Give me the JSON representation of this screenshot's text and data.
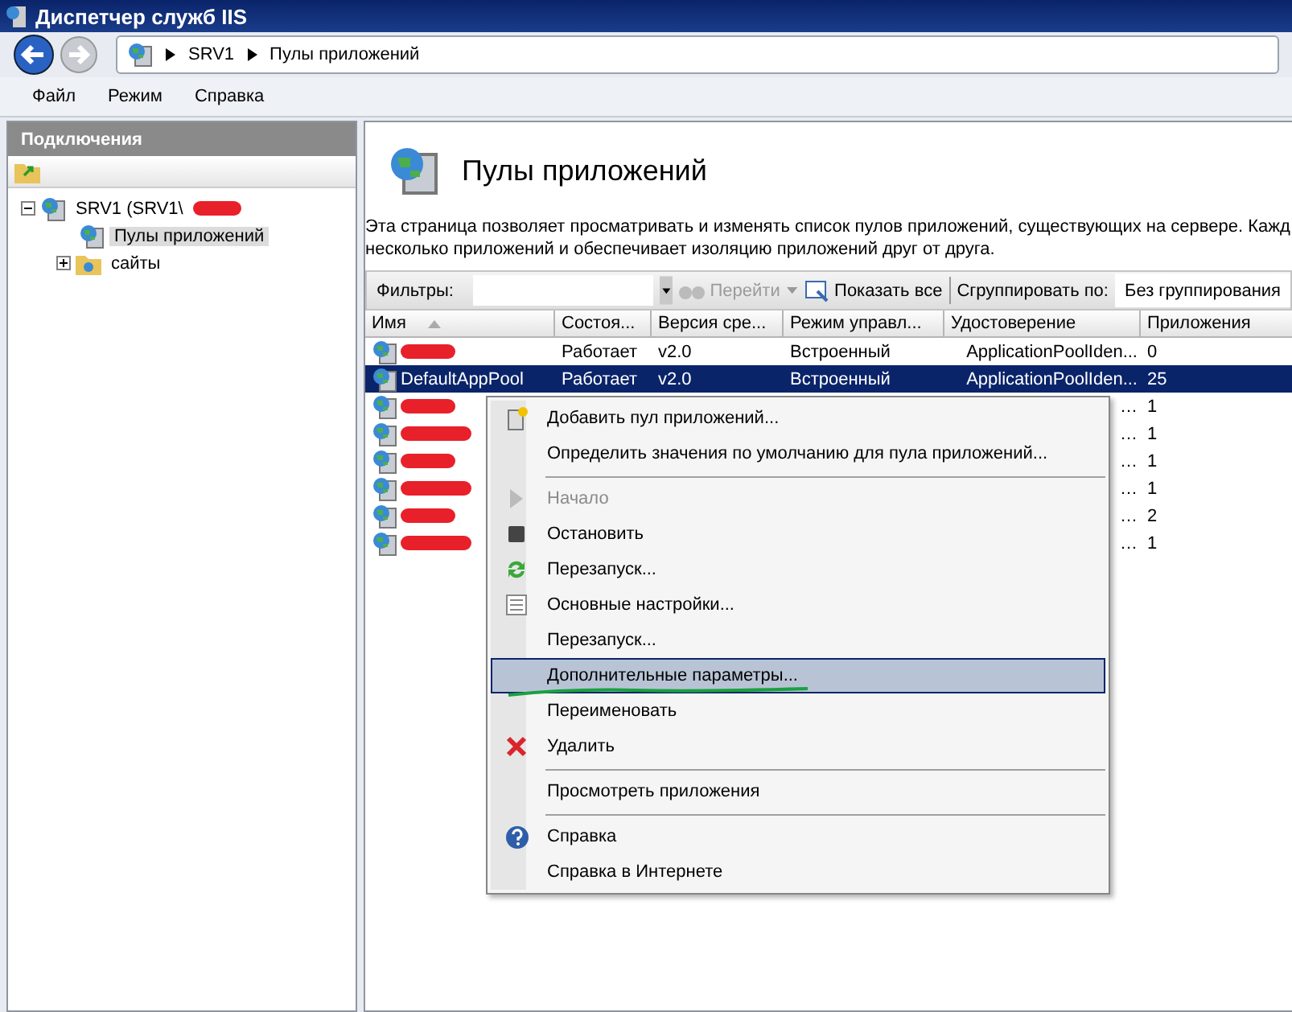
{
  "window": {
    "title": "Диспетчер служб IIS"
  },
  "address": {
    "crumbs": [
      "SRV1",
      "Пулы приложений"
    ]
  },
  "menu_bar": [
    "Файл",
    "Режим",
    "Справка"
  ],
  "connections": {
    "title": "Подключения",
    "tree": [
      {
        "label": "SRV1 (SRV1\\",
        "redacted": true,
        "expanded": true,
        "selected": false,
        "children": [
          {
            "label": "Пулы приложений",
            "redacted": false,
            "selected": true
          },
          {
            "label": "сайты",
            "redacted": false,
            "selected": false,
            "expanded": false
          }
        ]
      }
    ]
  },
  "page": {
    "title": "Пулы приложений",
    "description": [
      "Эта страница позволяет просматривать и изменять список пулов приложений, существующих на сервере. Кажд",
      "несколько приложений и обеспечивает изоляцию приложений друг от друга."
    ]
  },
  "filter_bar": {
    "label": "Фильтры:",
    "go": "Перейти",
    "go_disabled": true,
    "show_all": "Показать все",
    "group_label": "Сгруппировать по:",
    "group_value": "Без группирования"
  },
  "table": {
    "columns": [
      {
        "label": "Имя",
        "sorted": true
      },
      {
        "label": "Состоя...",
        "sorted": false
      },
      {
        "label": "Версия сре...",
        "sorted": false
      },
      {
        "label": "Режим управл...",
        "sorted": false
      },
      {
        "label": "Удостоверение",
        "sorted": false
      },
      {
        "label": "Приложения",
        "sorted": false
      }
    ],
    "rows": [
      {
        "redacted": true,
        "selected": false,
        "cells": [
          "",
          "Работает",
          "v2.0",
          "Встроенный",
          "ApplicationPoolIden...",
          "0"
        ]
      },
      {
        "redacted": false,
        "selected": true,
        "cells": [
          "DefaultAppPool",
          "Работает",
          "v2.0",
          "Встроенный",
          "ApplicationPoolIden...",
          "25"
        ]
      },
      {
        "redacted": true,
        "selected": false,
        "cells": [
          "",
          "",
          "",
          "",
          "…",
          "1"
        ]
      },
      {
        "redacted": true,
        "selected": false,
        "cells": [
          "",
          "",
          "",
          "",
          "…",
          "1"
        ]
      },
      {
        "redacted": true,
        "selected": false,
        "cells": [
          "",
          "",
          "",
          "",
          "…",
          "1"
        ]
      },
      {
        "redacted": true,
        "selected": false,
        "cells": [
          "",
          "",
          "",
          "",
          "…",
          "1"
        ]
      },
      {
        "redacted": true,
        "selected": false,
        "cells": [
          "",
          "",
          "",
          "",
          "…",
          "2"
        ]
      },
      {
        "redacted": true,
        "selected": false,
        "cells": [
          "",
          "",
          "",
          "",
          "…",
          "1"
        ]
      }
    ]
  },
  "context_menu": [
    {
      "kind": "item",
      "label": "Добавить пул приложений...",
      "disabled": false,
      "selected": false
    },
    {
      "kind": "item",
      "label": "Определить значения по умолчанию для пула приложений...",
      "disabled": false,
      "selected": false
    },
    {
      "kind": "separator"
    },
    {
      "kind": "item",
      "label": "Начало",
      "disabled": true,
      "selected": false
    },
    {
      "kind": "item",
      "label": "Остановить",
      "disabled": false,
      "selected": false
    },
    {
      "kind": "item",
      "label": "Перезапуск...",
      "disabled": false,
      "selected": false
    },
    {
      "kind": "item",
      "label": "Основные настройки...",
      "disabled": false,
      "selected": false
    },
    {
      "kind": "item",
      "label": "Перезапуск...",
      "disabled": false,
      "selected": false
    },
    {
      "kind": "item",
      "label": "Дополнительные параметры...",
      "disabled": false,
      "selected": true,
      "underlined": true
    },
    {
      "kind": "item",
      "label": "Переименовать",
      "disabled": false,
      "selected": false
    },
    {
      "kind": "item",
      "label": "Удалить",
      "disabled": false,
      "selected": false
    },
    {
      "kind": "separator"
    },
    {
      "kind": "item",
      "label": "Просмотреть приложения",
      "disabled": false,
      "selected": false
    },
    {
      "kind": "separator"
    },
    {
      "kind": "item",
      "label": "Справка",
      "disabled": false,
      "selected": false
    },
    {
      "kind": "item",
      "label": "Справка в Интернете",
      "disabled": false,
      "selected": false
    }
  ]
}
